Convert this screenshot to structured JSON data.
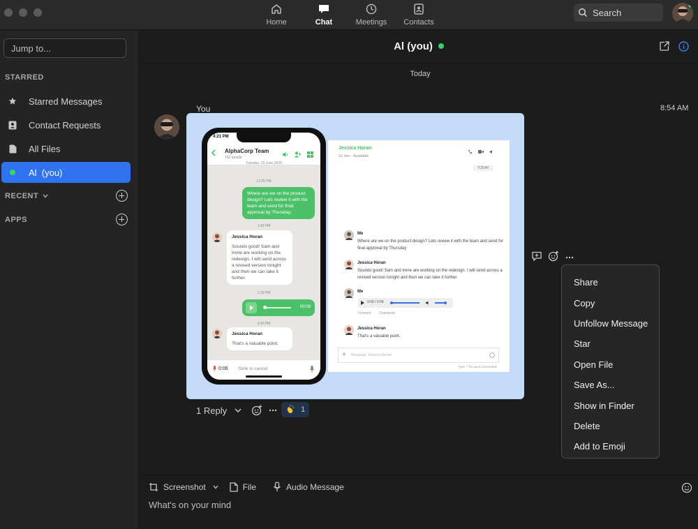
{
  "nav": {
    "home": "Home",
    "chat": "Chat",
    "meetings": "Meetings",
    "contacts": "Contacts",
    "search": "Search"
  },
  "sidebar": {
    "jump_placeholder": "Jump to...",
    "starred_label": "STARRED",
    "items": [
      {
        "label": "Starred Messages",
        "icon": "star-icon"
      },
      {
        "label": "Contact Requests",
        "icon": "contact-card-icon"
      },
      {
        "label": "All Files",
        "icon": "file-icon"
      },
      {
        "label": "Al  (you)",
        "icon": "online-dot"
      }
    ],
    "recent_label": "RECENT",
    "apps_label": "APPS"
  },
  "chat": {
    "title": "Al (you)",
    "date": "Today",
    "sender": "You",
    "time": "8:54 AM",
    "reply_count": "1 Reply",
    "reaction_count": "1"
  },
  "attachment": {
    "phone": {
      "clock": "4:21 PM",
      "group_name": "AlphaCorp Team",
      "group_sub": "162 people",
      "date": "Tuesday, 29 June 2020",
      "t1": "12:29 PM",
      "msg1": "Where are we on the product design? Lets review it with the team and send for final approval by Thursday.",
      "t2": "1:43 PM",
      "name1": "Jessica Horan",
      "msg2": "Sounds good! Sam and Irene are working on the redesign. I will send across a revised version tonight and then we can take it further.",
      "t3": "2:29 PM",
      "audio_dur": "00:09",
      "t4": "3:43 PM",
      "name2": "Jessica Horan",
      "msg3": "That's a valuable point.",
      "rec_time": "0:06",
      "slide": "Slide to cancel"
    },
    "desktop": {
      "name": "Jessica Horan",
      "sub": "10 min  ·  Available",
      "today": "TODAY",
      "me1": "Me",
      "m1": "Where are we on the product design? Lets review it with the team and send for final approval by Thursday",
      "j1": "Jessica Horan",
      "m2": "Sounds good! Sam and Irene are working on the redesign. I will send across a revised version tonight and then we can take it further.",
      "me2": "Me",
      "audio_time": "0:00 / 0:09",
      "forward": "Forward",
      "download": "Download",
      "j2": "Jessica Horan",
      "m3": "That's a valuable point.",
      "input_ph": "Message Jessica Horan",
      "hint": "Type '/' for quick commands"
    }
  },
  "context_menu": [
    "Share",
    "Copy",
    "Unfollow Message",
    "Star",
    "Open File",
    "Save As...",
    "Show in Finder",
    "Delete",
    "Add to Emoji"
  ],
  "composer": {
    "screenshot": "Screenshot",
    "file": "File",
    "audio": "Audio Message",
    "placeholder": "What's on your mind"
  },
  "colors": {
    "accent": "#2f73f0",
    "online": "#3bd16f",
    "brand_green": "#4cc16a",
    "attachment_bg": "#c3dbf6"
  }
}
